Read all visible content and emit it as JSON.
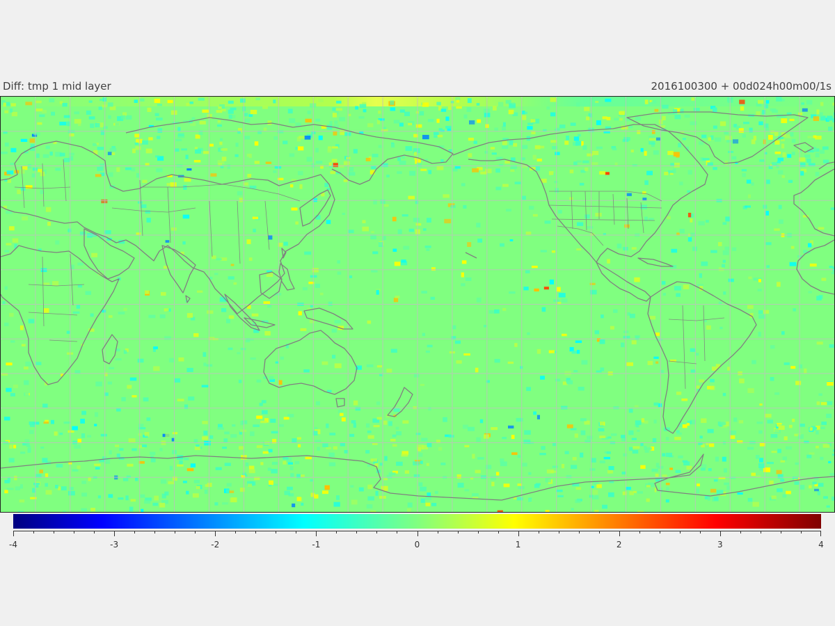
{
  "header": {
    "left_title": "Diff: tmp 1 mid layer",
    "right_title": "2016100300 + 00d024h00m00/1s"
  },
  "map": {
    "projection": "equirectangular",
    "central_longitude": 180,
    "background_value_color": "#80ff80",
    "coastline_color": "#808080",
    "gridline_color": "#c0c0c0",
    "gridlines": true
  },
  "colorbar": {
    "min": -4,
    "max": 4,
    "colormap": "jet",
    "tick_labels": [
      "-4",
      "-3",
      "-2",
      "-1",
      "0",
      "1",
      "2",
      "3",
      "4"
    ],
    "minor_ticks_per_unit": 5,
    "colors": [
      "#000080",
      "#0000ff",
      "#00ffff",
      "#80ff80",
      "#ffff00",
      "#ff0000",
      "#800000"
    ]
  }
}
